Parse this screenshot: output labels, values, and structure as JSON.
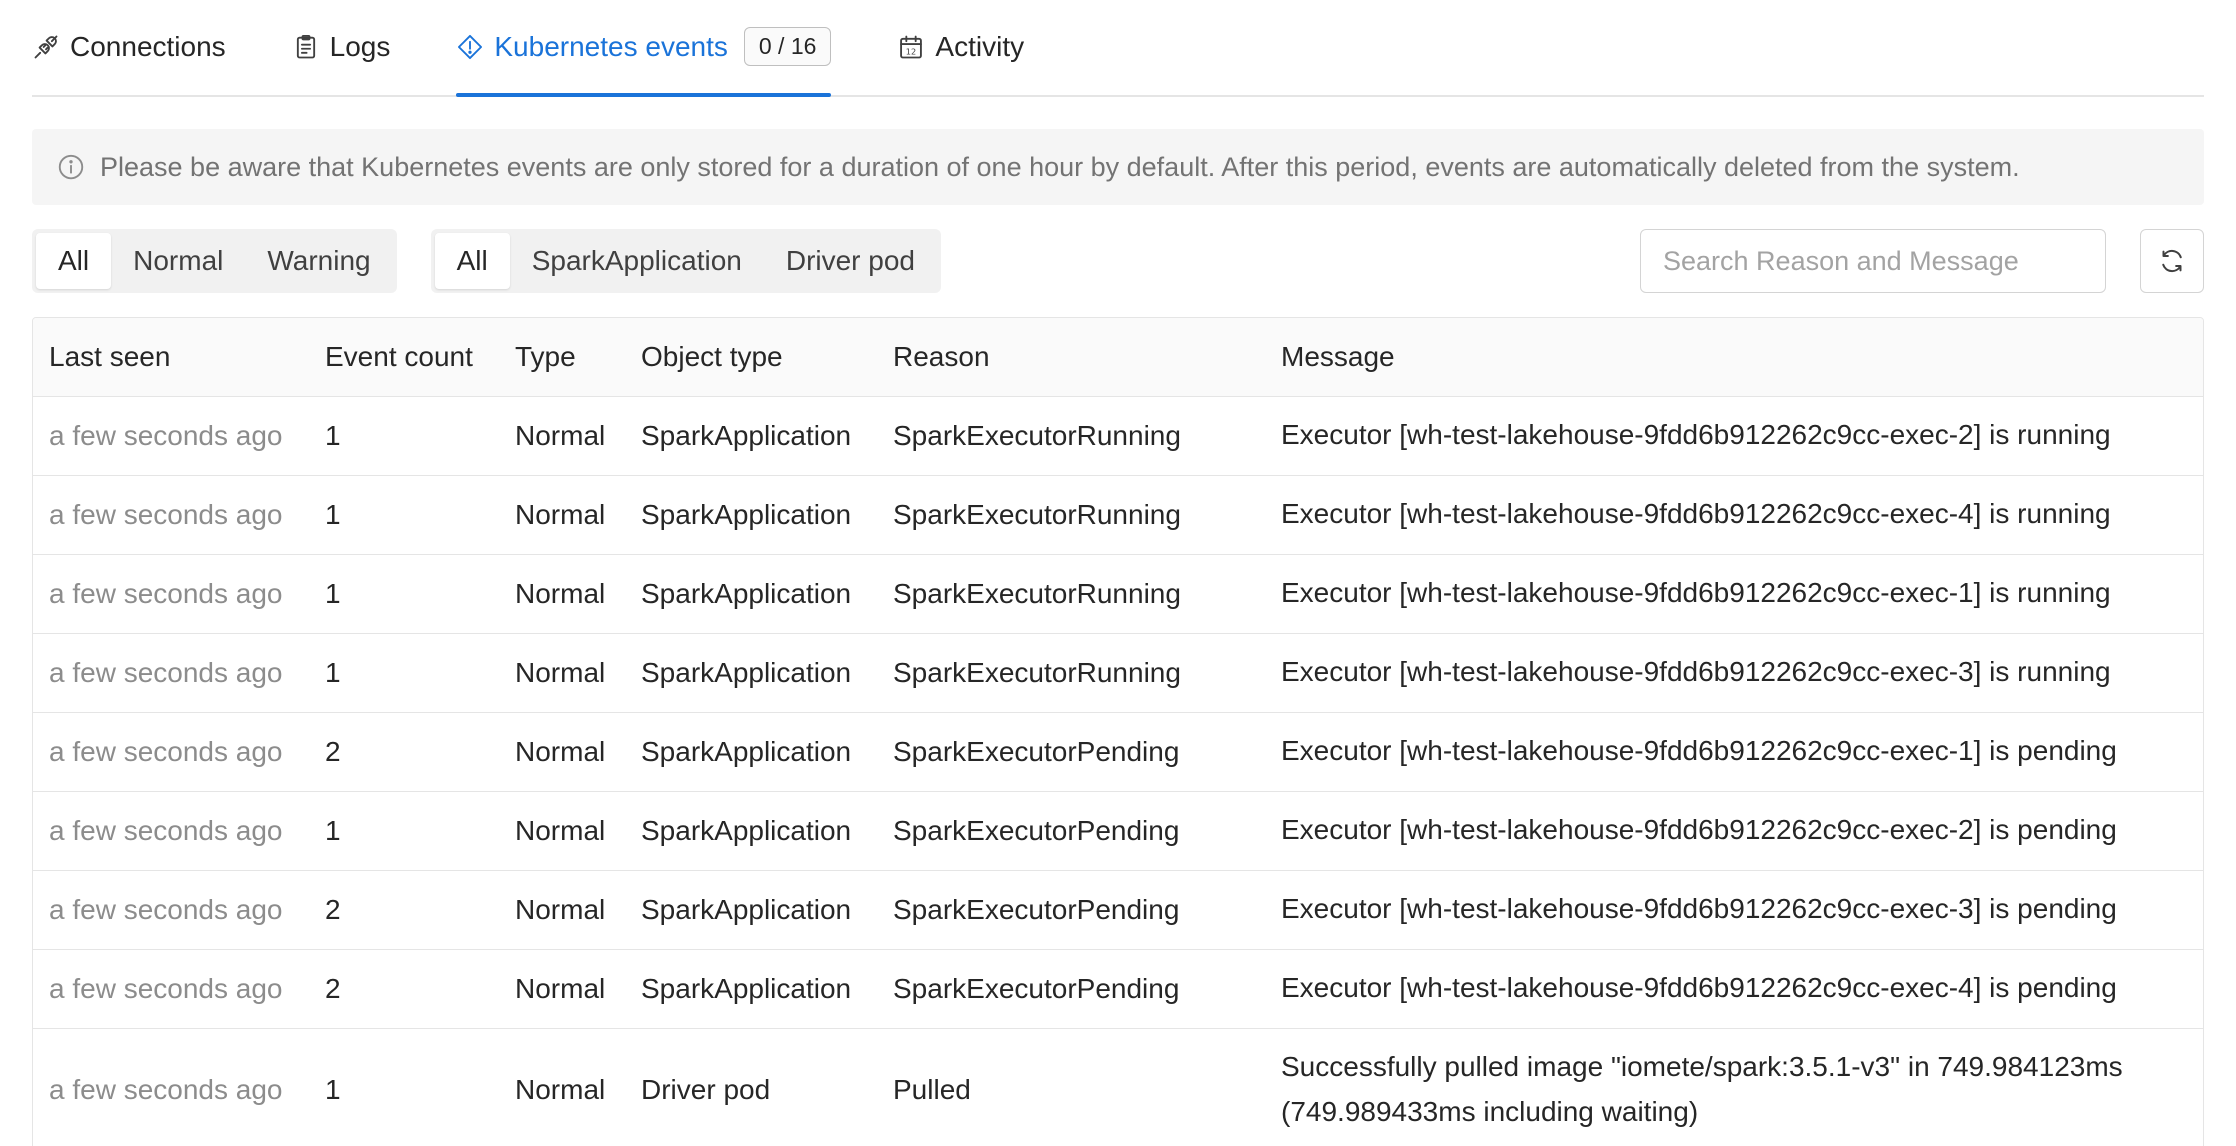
{
  "tabs": [
    {
      "label": "Connections",
      "icon": "plug-icon",
      "active": false
    },
    {
      "label": "Logs",
      "icon": "clipboard-icon",
      "active": false
    },
    {
      "label": "Kubernetes events",
      "icon": "warning-diamond-icon",
      "active": true,
      "count": "0 / 16"
    },
    {
      "label": "Activity",
      "icon": "calendar-icon",
      "active": false
    }
  ],
  "notice": "Please be aware that Kubernetes events are only stored for a duration of one hour by default. After this period, events are automatically deleted from the system.",
  "filters": {
    "type_options": [
      "All",
      "Normal",
      "Warning"
    ],
    "type_selected": "All",
    "object_options": [
      "All",
      "SparkApplication",
      "Driver pod"
    ],
    "object_selected": "All",
    "search_placeholder": "Search Reason and Message"
  },
  "table": {
    "columns": [
      "Last seen",
      "Event count",
      "Type",
      "Object type",
      "Reason",
      "Message"
    ],
    "rows": [
      [
        "a few seconds ago",
        "1",
        "Normal",
        "SparkApplication",
        "SparkExecutorRunning",
        "Executor [wh-test-lakehouse-9fdd6b912262c9cc-exec-2] is running"
      ],
      [
        "a few seconds ago",
        "1",
        "Normal",
        "SparkApplication",
        "SparkExecutorRunning",
        "Executor [wh-test-lakehouse-9fdd6b912262c9cc-exec-4] is running"
      ],
      [
        "a few seconds ago",
        "1",
        "Normal",
        "SparkApplication",
        "SparkExecutorRunning",
        "Executor [wh-test-lakehouse-9fdd6b912262c9cc-exec-1] is running"
      ],
      [
        "a few seconds ago",
        "1",
        "Normal",
        "SparkApplication",
        "SparkExecutorRunning",
        "Executor [wh-test-lakehouse-9fdd6b912262c9cc-exec-3] is running"
      ],
      [
        "a few seconds ago",
        "2",
        "Normal",
        "SparkApplication",
        "SparkExecutorPending",
        "Executor [wh-test-lakehouse-9fdd6b912262c9cc-exec-1] is pending"
      ],
      [
        "a few seconds ago",
        "1",
        "Normal",
        "SparkApplication",
        "SparkExecutorPending",
        "Executor [wh-test-lakehouse-9fdd6b912262c9cc-exec-2] is pending"
      ],
      [
        "a few seconds ago",
        "2",
        "Normal",
        "SparkApplication",
        "SparkExecutorPending",
        "Executor [wh-test-lakehouse-9fdd6b912262c9cc-exec-3] is pending"
      ],
      [
        "a few seconds ago",
        "2",
        "Normal",
        "SparkApplication",
        "SparkExecutorPending",
        "Executor [wh-test-lakehouse-9fdd6b912262c9cc-exec-4] is pending"
      ],
      [
        "a few seconds ago",
        "1",
        "Normal",
        "Driver pod",
        "Pulled",
        "Successfully pulled image \"iomete/spark:3.5.1-v3\" in 749.984123ms (749.989433ms including waiting)"
      ]
    ]
  },
  "colors": {
    "accent": "#1a73d9",
    "muted_text": "#8c8c8c",
    "border": "#e5e5e5"
  }
}
